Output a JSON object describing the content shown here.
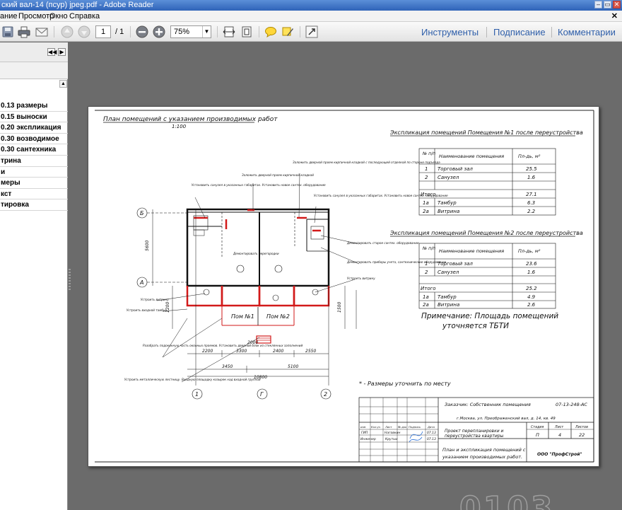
{
  "window": {
    "title": "ский вал-14 (псур) jpeg.pdf - Adobe Reader",
    "controls": [
      "–",
      "▭",
      "✕"
    ]
  },
  "menu": {
    "items": [
      "ание",
      "Просмотр",
      "Окно",
      "Справка"
    ],
    "close": "✕"
  },
  "toolbar": {
    "page_current": "1",
    "page_total": "/ 1",
    "zoom": "75%",
    "links": [
      "Инструменты",
      "Подписание",
      "Комментарии"
    ]
  },
  "sidebar": {
    "layers": [
      "0.13 размеры",
      "0.15 выноски",
      "0.20 экспликация",
      "0.30 возводимое",
      "0.30 сантехника",
      "трина",
      "и",
      "меры",
      "кст",
      "тировка"
    ]
  },
  "drawing": {
    "plan_title": "План помещений с указанием производимых работ",
    "plan_scale": "1:100",
    "table1": {
      "title": "Экспликация помещений Помещения №1 после переустройства",
      "header": [
        "№ п/п",
        "Наименование помещения",
        "Пл-дь, м²"
      ],
      "rows": [
        [
          "1",
          "Торговый зал",
          "25.5"
        ],
        [
          "2",
          "Санузел",
          "1.6"
        ],
        [
          "",
          "",
          ""
        ],
        [
          "Итого",
          "",
          "27.1"
        ],
        [
          "1а",
          "Тамбур",
          "6.3"
        ],
        [
          "2а",
          "Витрина",
          "2.2"
        ]
      ]
    },
    "table2": {
      "title": "Экспликация помещений Помещения №2 после переустройства",
      "header": [
        "№ п/п",
        "Наименование помещения",
        "Пл-дь, м²"
      ],
      "rows": [
        [
          "1",
          "Торговый зал",
          "23.6"
        ],
        [
          "2",
          "Санузел",
          "1.6"
        ],
        [
          "",
          "",
          ""
        ],
        [
          "Итого",
          "",
          "25.2"
        ],
        [
          "1а",
          "Тамбур",
          "4.9"
        ],
        [
          "2а",
          "Витрина",
          "2.6"
        ]
      ]
    },
    "note": [
      "Примечание: Площадь помещений",
      "уточняется ТБТИ"
    ],
    "dims_note": "* - Размеры уточнить по месту",
    "room_labels": [
      "Пом №1",
      "Пом №2"
    ],
    "axis_letters": [
      "Б",
      "А"
    ],
    "axis_numbers": [
      "1",
      "Г",
      "2"
    ],
    "dims_bottom": [
      "2200",
      "3300",
      "2400",
      "2550"
    ],
    "dims_bottom2": [
      "3450",
      "5100"
    ],
    "dims_total": "10800",
    "dim_2000": "2000",
    "dims_left": [
      "5600",
      "1500",
      "1200"
    ],
    "annotations": [
      "Заложить дверной проем кирпичной кладкой",
      "Установить санузел в указанных габаритах. Установить новое сантех. оборудование",
      "Заложить дверной проем кирпичной кладкой с последующей отделкой по стороне подъезда",
      "Установить санузел в указанных габаритах. Установить новое сантех. оборудование",
      "Демонтировать перегородки",
      "Демонтировать старое сантех. оборудование",
      "Демонтировать приборы учета, сантехнические оборудование",
      "Устроить витрину",
      "Устроить витрину",
      "Устроить входной тамбур",
      "Разобрать подоконную часть оконных проемов. Установить дверной блок из стеклянных заполнений",
      "Устроить металлическую лестницу. Входную площадку козырек над входной группой"
    ],
    "stamp": {
      "customer": "Заказчик: Собственник помещения",
      "code": "07-13-248-АС",
      "address": "г.Москва, ул. Преображенский вал, д. 14, кв. 49",
      "project": [
        "Проект перепланировки и",
        "переустройства квартиры"
      ],
      "sheet_title": [
        "План и экспликация помещений с",
        "указанием производимых работ."
      ],
      "headers_left": [
        "изм",
        "Кол.уч",
        "Лист",
        "№ док",
        "Подпись",
        "Дата"
      ],
      "person_rows": [
        [
          "ГИП",
          "Наговкин",
          "",
          "07.13"
        ],
        [
          "Инженер",
          "Крутых",
          "",
          "07.13"
        ]
      ],
      "stage_head": [
        "Стадия",
        "Лист",
        "Листов"
      ],
      "stage_vals": [
        "П",
        "4",
        "22"
      ],
      "company": "ООО \"ПрофСтрой\""
    }
  },
  "watermark": "0103"
}
